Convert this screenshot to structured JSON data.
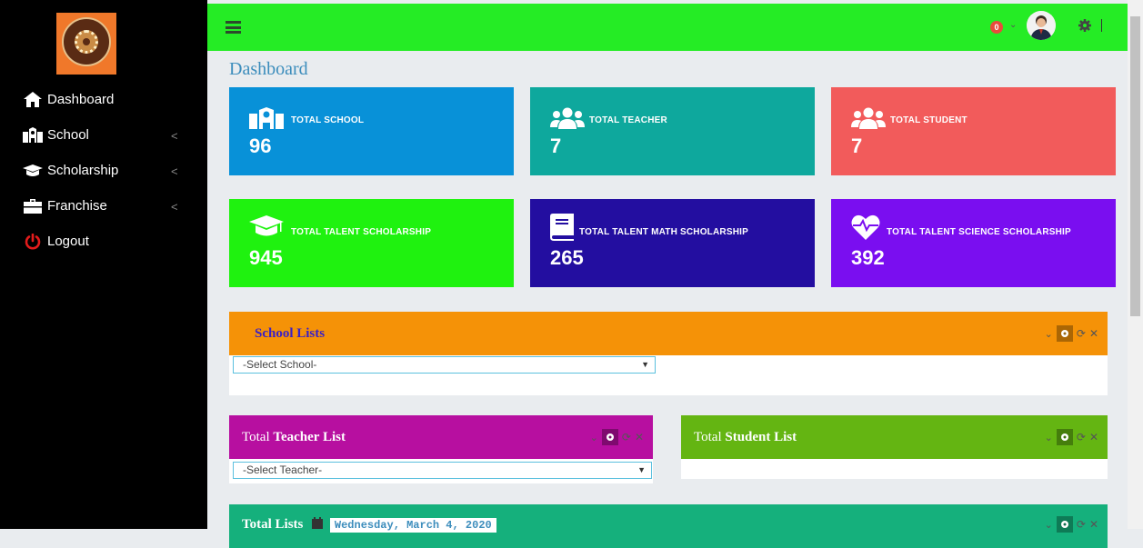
{
  "sidebar": {
    "items": [
      {
        "label": "Dashboard",
        "icon": "home-icon"
      },
      {
        "label": "School",
        "icon": "school-icon",
        "chevron": "<"
      },
      {
        "label": "Scholarship",
        "icon": "graduation-cap-icon",
        "chevron": "<"
      },
      {
        "label": "Franchise",
        "icon": "briefcase-icon",
        "chevron": "<"
      },
      {
        "label": "Logout",
        "icon": "power-icon"
      }
    ]
  },
  "topbar": {
    "notification_count": "0",
    "colors": {
      "bar": "#25ec25"
    }
  },
  "page_title": "Dashboard",
  "stats": [
    {
      "label": "TOTAL SCHOOL",
      "value": "96",
      "color": "#0891d8",
      "icon": "school-icon"
    },
    {
      "label": "TOTAL TEACHER",
      "value": "7",
      "color": "#0ea89d",
      "icon": "users-icon"
    },
    {
      "label": "TOTAL STUDENT",
      "value": "7",
      "color": "#f25b5b",
      "icon": "users-icon"
    },
    {
      "label": "TOTAL TALENT SCHOLARSHIP",
      "value": "945",
      "color": "#1ff20f",
      "icon": "graduation-cap-icon"
    },
    {
      "label": "TOTAL TALENT MATH SCHOLARSHIP",
      "value": "265",
      "color": "#230ea0",
      "icon": "book-icon"
    },
    {
      "label": "TOTAL TALENT SCIENCE SCHOLARSHIP",
      "value": "392",
      "color": "#7a0ef0",
      "icon": "heartbeat-icon"
    }
  ],
  "school_panel": {
    "title": "School Lists",
    "select_value": "-Select School-",
    "color": "#f59207"
  },
  "teacher_panel": {
    "title_prefix": "Total ",
    "title_bold": "Teacher List",
    "select_value": "-Select Teacher-",
    "color": "#b70fa0"
  },
  "student_panel": {
    "title_prefix": "Total ",
    "title_bold": "Student List",
    "color": "#64b512"
  },
  "lists_panel": {
    "title": "Total Lists",
    "date": "Wednesday, March 4, 2020",
    "color": "#15b07c"
  }
}
